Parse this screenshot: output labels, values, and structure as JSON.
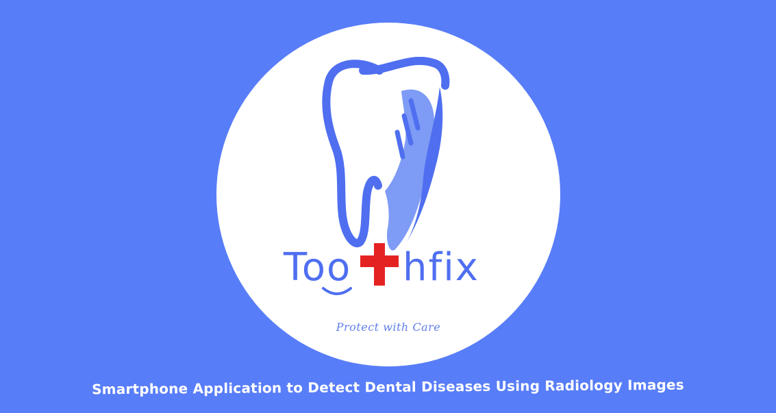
{
  "brand": {
    "name": "Toothfix",
    "wordmark_parts": [
      "Too",
      "hfix"
    ],
    "tagline": "Protect with Care",
    "logo_icon": "tooth-icon",
    "cross_icon": "red-cross-icon"
  },
  "subtitle": "Smartphone Application to Detect Dental Diseases Using Radiology Images",
  "colors": {
    "background": "#587df8",
    "circle": "#ffffff",
    "brand_blue": "#4f6ff0",
    "tooth_light": "#7e9bf5",
    "cross_red": "#e52222"
  }
}
